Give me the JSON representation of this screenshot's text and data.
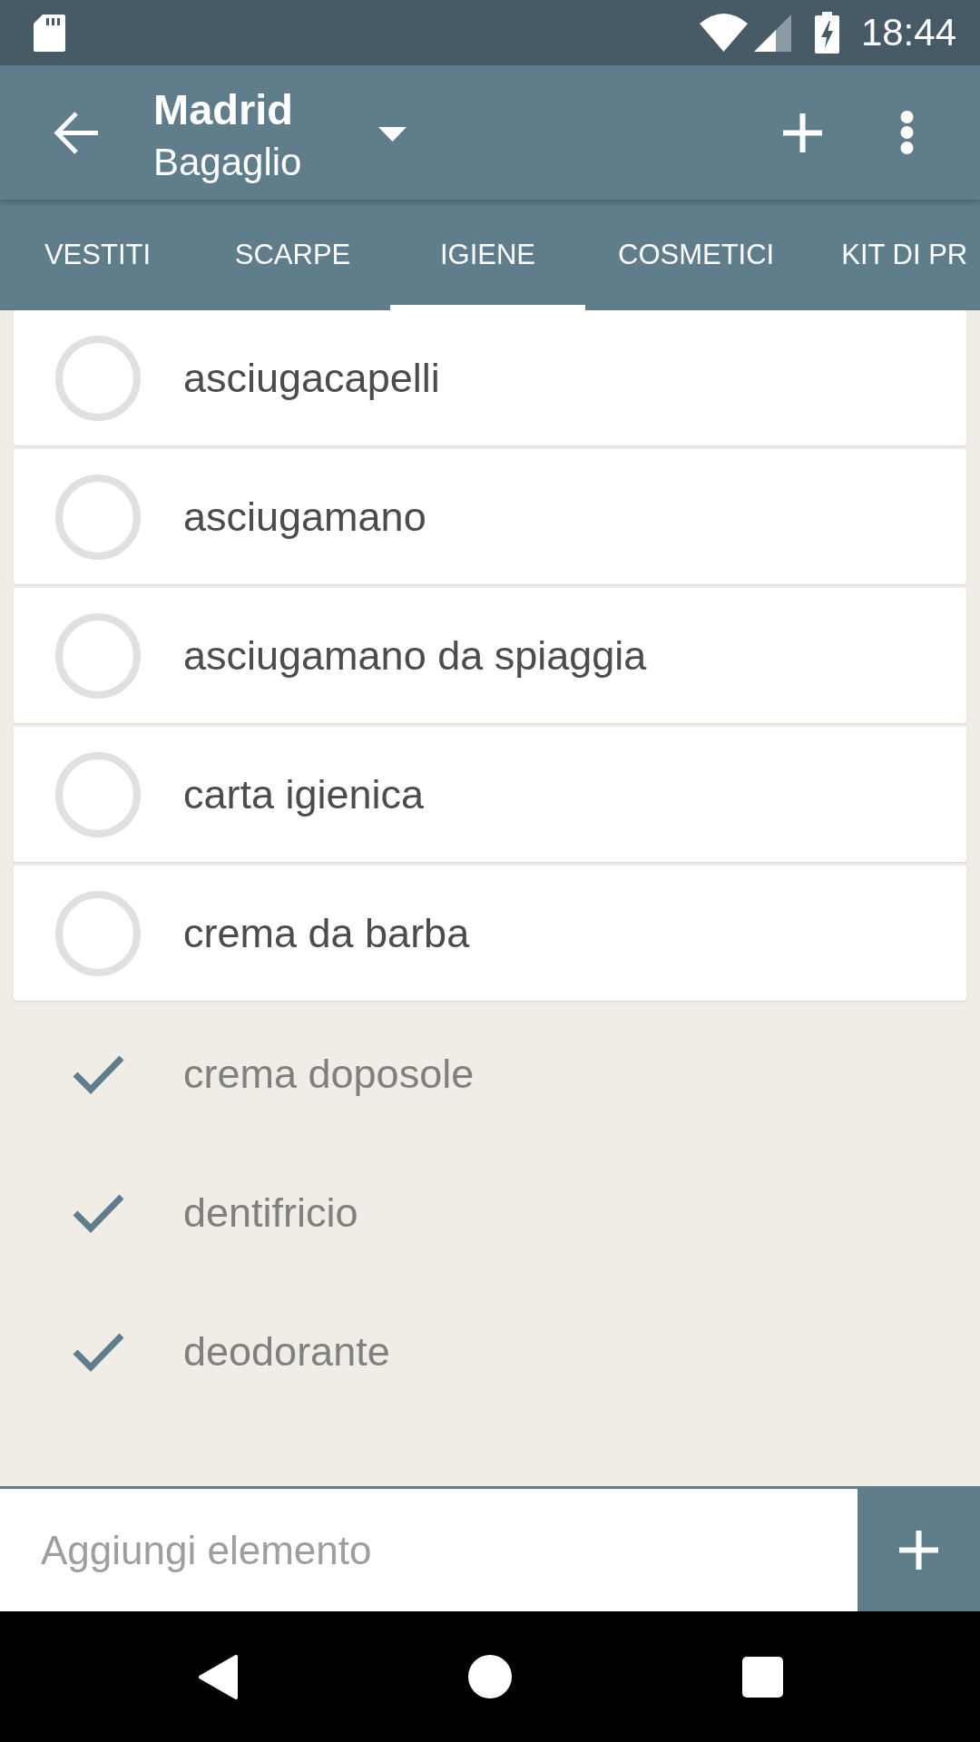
{
  "status_bar": {
    "time": "18:44"
  },
  "app_bar": {
    "title": "Madrid",
    "subtitle": "Bagaglio"
  },
  "tabs": [
    {
      "label": "VESTITI",
      "selected": false
    },
    {
      "label": "SCARPE",
      "selected": false
    },
    {
      "label": "IGIENE",
      "selected": true
    },
    {
      "label": "COSMETICI",
      "selected": false
    },
    {
      "label": "KIT DI PR",
      "selected": false
    }
  ],
  "items": [
    {
      "label": "asciugacapelli",
      "checked": false
    },
    {
      "label": "asciugamano",
      "checked": false
    },
    {
      "label": "asciugamano da spiaggia",
      "checked": false
    },
    {
      "label": "carta igienica",
      "checked": false
    },
    {
      "label": "crema da barba",
      "checked": false
    },
    {
      "label": "crema doposole",
      "checked": true
    },
    {
      "label": "dentifricio",
      "checked": true
    },
    {
      "label": "deodorante",
      "checked": true
    }
  ],
  "add_bar": {
    "placeholder": "Aggiungi elemento"
  }
}
